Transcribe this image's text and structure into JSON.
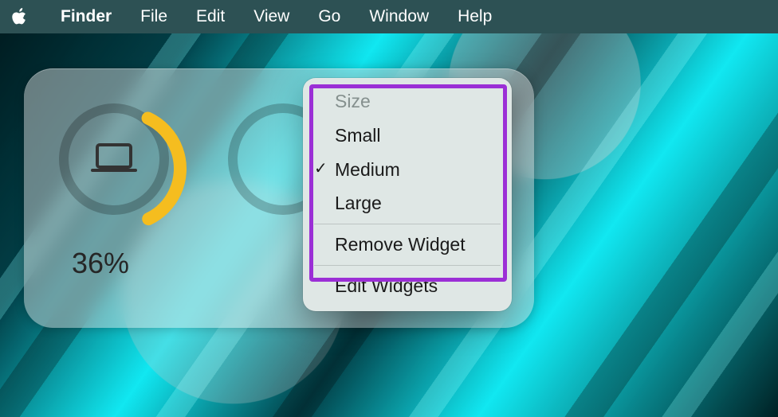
{
  "menubar": {
    "app": "Finder",
    "items": [
      "File",
      "Edit",
      "View",
      "Go",
      "Window",
      "Help"
    ]
  },
  "widget": {
    "battery_pct_label": "36%",
    "battery_pct_value": 36
  },
  "popup": {
    "header": "Size",
    "sizes": [
      "Small",
      "Medium",
      "Large"
    ],
    "selected": "Medium",
    "remove": "Remove Widget",
    "edit": "Edit Widgets"
  },
  "colors": {
    "accent_arc": "#f5bd1f",
    "highlight_border": "#9b2fd6",
    "menubar_bg": "#2d5154"
  }
}
